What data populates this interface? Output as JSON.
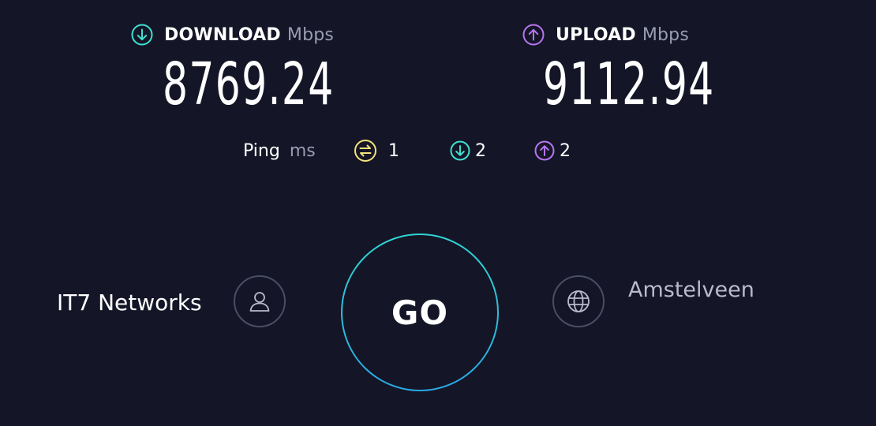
{
  "download": {
    "label": "DOWNLOAD",
    "unit": "Mbps",
    "value": "8769.24",
    "icon": "download-arrow-icon",
    "color": "#3fe0d0"
  },
  "upload": {
    "label": "UPLOAD",
    "unit": "Mbps",
    "value": "9112.94",
    "icon": "upload-arrow-icon",
    "color": "#b675f0"
  },
  "ping": {
    "label": "Ping",
    "unit": "ms",
    "idle": {
      "value": "1",
      "icon": "ping-idle-icon",
      "color": "#f2e27a"
    },
    "download": {
      "value": "2",
      "icon": "ping-download-icon",
      "color": "#3fe0d0"
    },
    "upload": {
      "value": "2",
      "icon": "ping-upload-icon",
      "color": "#b675f0"
    }
  },
  "go_button": {
    "label": "GO"
  },
  "provider": {
    "name": "IT7 Networks",
    "icon": "user-icon"
  },
  "server": {
    "name": "Amstelveen",
    "icon": "globe-icon"
  },
  "colors": {
    "background": "#141526",
    "muted_text": "#9a9cb1",
    "ring_gradient_start": "#2fd6d3",
    "ring_gradient_end": "#2aa7e6"
  }
}
